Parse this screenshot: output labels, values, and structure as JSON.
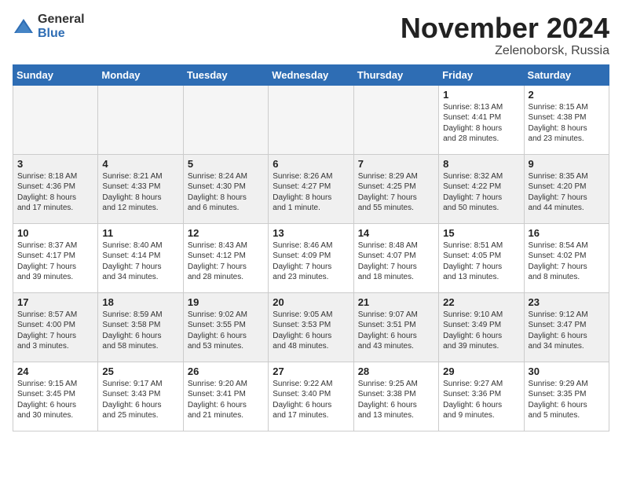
{
  "logo": {
    "general": "General",
    "blue": "Blue"
  },
  "title": "November 2024",
  "location": "Zelenoborsk, Russia",
  "headers": [
    "Sunday",
    "Monday",
    "Tuesday",
    "Wednesday",
    "Thursday",
    "Friday",
    "Saturday"
  ],
  "weeks": [
    [
      {
        "day": "",
        "info": ""
      },
      {
        "day": "",
        "info": ""
      },
      {
        "day": "",
        "info": ""
      },
      {
        "day": "",
        "info": ""
      },
      {
        "day": "",
        "info": ""
      },
      {
        "day": "1",
        "info": "Sunrise: 8:13 AM\nSunset: 4:41 PM\nDaylight: 8 hours\nand 28 minutes."
      },
      {
        "day": "2",
        "info": "Sunrise: 8:15 AM\nSunset: 4:38 PM\nDaylight: 8 hours\nand 23 minutes."
      }
    ],
    [
      {
        "day": "3",
        "info": "Sunrise: 8:18 AM\nSunset: 4:36 PM\nDaylight: 8 hours\nand 17 minutes."
      },
      {
        "day": "4",
        "info": "Sunrise: 8:21 AM\nSunset: 4:33 PM\nDaylight: 8 hours\nand 12 minutes."
      },
      {
        "day": "5",
        "info": "Sunrise: 8:24 AM\nSunset: 4:30 PM\nDaylight: 8 hours\nand 6 minutes."
      },
      {
        "day": "6",
        "info": "Sunrise: 8:26 AM\nSunset: 4:27 PM\nDaylight: 8 hours\nand 1 minute."
      },
      {
        "day": "7",
        "info": "Sunrise: 8:29 AM\nSunset: 4:25 PM\nDaylight: 7 hours\nand 55 minutes."
      },
      {
        "day": "8",
        "info": "Sunrise: 8:32 AM\nSunset: 4:22 PM\nDaylight: 7 hours\nand 50 minutes."
      },
      {
        "day": "9",
        "info": "Sunrise: 8:35 AM\nSunset: 4:20 PM\nDaylight: 7 hours\nand 44 minutes."
      }
    ],
    [
      {
        "day": "10",
        "info": "Sunrise: 8:37 AM\nSunset: 4:17 PM\nDaylight: 7 hours\nand 39 minutes."
      },
      {
        "day": "11",
        "info": "Sunrise: 8:40 AM\nSunset: 4:14 PM\nDaylight: 7 hours\nand 34 minutes."
      },
      {
        "day": "12",
        "info": "Sunrise: 8:43 AM\nSunset: 4:12 PM\nDaylight: 7 hours\nand 28 minutes."
      },
      {
        "day": "13",
        "info": "Sunrise: 8:46 AM\nSunset: 4:09 PM\nDaylight: 7 hours\nand 23 minutes."
      },
      {
        "day": "14",
        "info": "Sunrise: 8:48 AM\nSunset: 4:07 PM\nDaylight: 7 hours\nand 18 minutes."
      },
      {
        "day": "15",
        "info": "Sunrise: 8:51 AM\nSunset: 4:05 PM\nDaylight: 7 hours\nand 13 minutes."
      },
      {
        "day": "16",
        "info": "Sunrise: 8:54 AM\nSunset: 4:02 PM\nDaylight: 7 hours\nand 8 minutes."
      }
    ],
    [
      {
        "day": "17",
        "info": "Sunrise: 8:57 AM\nSunset: 4:00 PM\nDaylight: 7 hours\nand 3 minutes."
      },
      {
        "day": "18",
        "info": "Sunrise: 8:59 AM\nSunset: 3:58 PM\nDaylight: 6 hours\nand 58 minutes."
      },
      {
        "day": "19",
        "info": "Sunrise: 9:02 AM\nSunset: 3:55 PM\nDaylight: 6 hours\nand 53 minutes."
      },
      {
        "day": "20",
        "info": "Sunrise: 9:05 AM\nSunset: 3:53 PM\nDaylight: 6 hours\nand 48 minutes."
      },
      {
        "day": "21",
        "info": "Sunrise: 9:07 AM\nSunset: 3:51 PM\nDaylight: 6 hours\nand 43 minutes."
      },
      {
        "day": "22",
        "info": "Sunrise: 9:10 AM\nSunset: 3:49 PM\nDaylight: 6 hours\nand 39 minutes."
      },
      {
        "day": "23",
        "info": "Sunrise: 9:12 AM\nSunset: 3:47 PM\nDaylight: 6 hours\nand 34 minutes."
      }
    ],
    [
      {
        "day": "24",
        "info": "Sunrise: 9:15 AM\nSunset: 3:45 PM\nDaylight: 6 hours\nand 30 minutes."
      },
      {
        "day": "25",
        "info": "Sunrise: 9:17 AM\nSunset: 3:43 PM\nDaylight: 6 hours\nand 25 minutes."
      },
      {
        "day": "26",
        "info": "Sunrise: 9:20 AM\nSunset: 3:41 PM\nDaylight: 6 hours\nand 21 minutes."
      },
      {
        "day": "27",
        "info": "Sunrise: 9:22 AM\nSunset: 3:40 PM\nDaylight: 6 hours\nand 17 minutes."
      },
      {
        "day": "28",
        "info": "Sunrise: 9:25 AM\nSunset: 3:38 PM\nDaylight: 6 hours\nand 13 minutes."
      },
      {
        "day": "29",
        "info": "Sunrise: 9:27 AM\nSunset: 3:36 PM\nDaylight: 6 hours\nand 9 minutes."
      },
      {
        "day": "30",
        "info": "Sunrise: 9:29 AM\nSunset: 3:35 PM\nDaylight: 6 hours\nand 5 minutes."
      }
    ]
  ]
}
